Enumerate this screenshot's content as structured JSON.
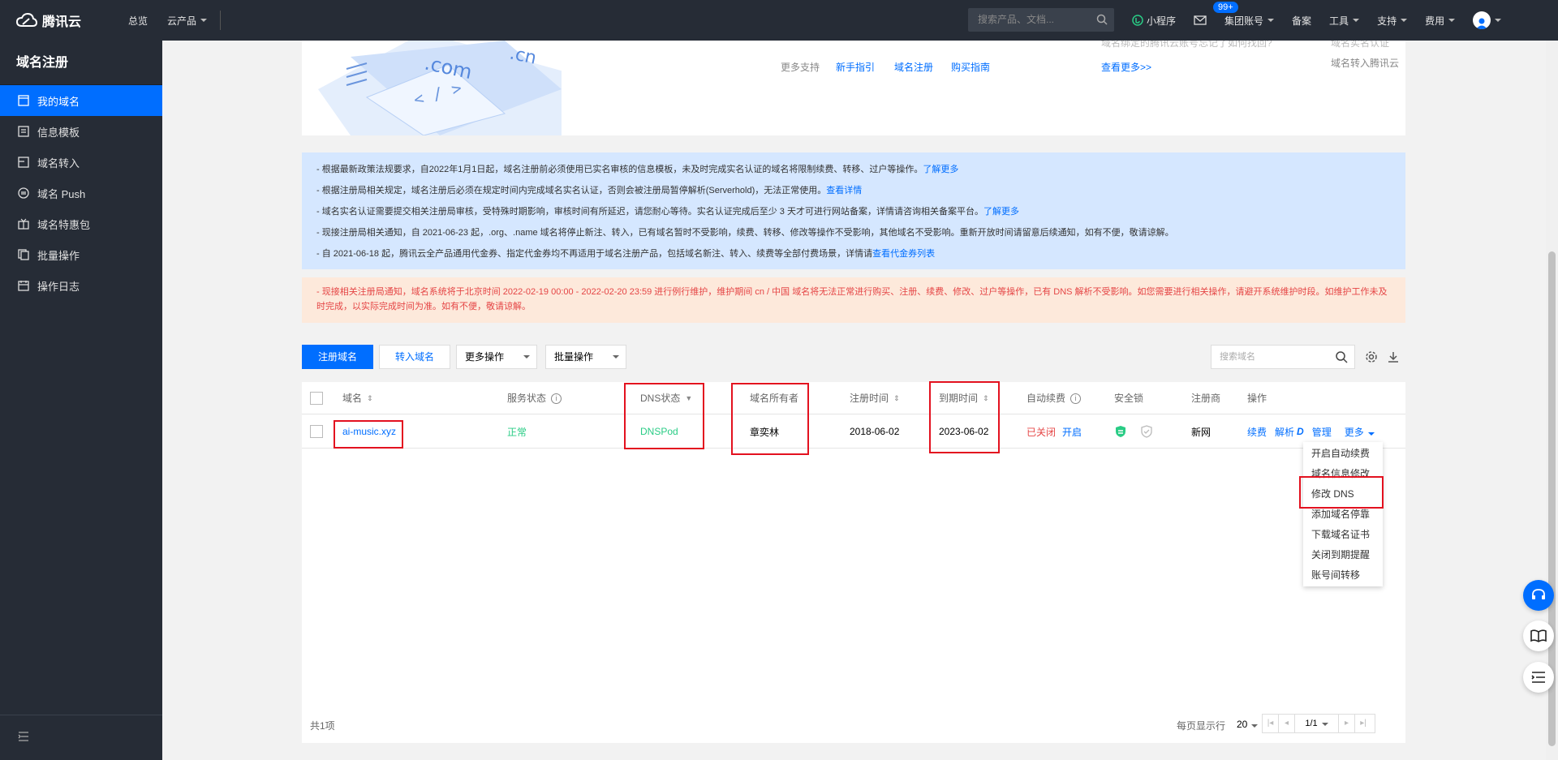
{
  "topbar": {
    "logo": "腾讯云",
    "nav": [
      "总览",
      "云产品"
    ],
    "search_placeholder": "搜索产品、文档...",
    "miniprogram": "小程序",
    "mail_badge": "99+",
    "group_account": "集团账号",
    "beian": "备案",
    "tools": "工具",
    "support": "支持",
    "billing": "费用"
  },
  "sidebar": {
    "title": "域名注册",
    "items": [
      {
        "label": "我的域名",
        "active": true
      },
      {
        "label": "信息模板"
      },
      {
        "label": "域名转入"
      },
      {
        "label": "域名 Push"
      },
      {
        "label": "域名特惠包"
      },
      {
        "label": "批量操作"
      },
      {
        "label": "操作日志"
      }
    ]
  },
  "banner": {
    "art_text_1": ".com",
    "art_text_2": ".cn",
    "more_support": "更多支持",
    "newbie_guide": "新手指引",
    "domain_reg": "域名注册",
    "buy_guide": "购买指南",
    "faded_q": "域名绑定的腾讯云账号忘记了如何找回?",
    "see_more": "查看更多>>",
    "faded_r1": "域名实名认证",
    "faded_r2": "域名转入腾讯云"
  },
  "notices": {
    "blue": [
      {
        "text": "- 根据最新政策法规要求，自2022年1月1日起，域名注册前必须使用已实名审核的信息模板，未及时完成实名认证的域名将限制续费、转移、过户等操作。",
        "link": "了解更多"
      },
      {
        "text": "- 根据注册局相关规定，域名注册后必须在规定时间内完成域名实名认证，否则会被注册局暂停解析(Serverhold)，无法正常使用。",
        "link": "查看详情"
      },
      {
        "text": "- 域名实名认证需要提交相关注册局审核，受特殊时期影响，审核时间有所延迟，请您耐心等待。实名认证完成后至少 3 天才可进行网站备案，详情请咨询相关备案平台。",
        "link": "了解更多"
      },
      {
        "text": "- 现接注册局相关通知，自 2021-06-23 起，.org、.name 域名将停止新注、转入，已有域名暂时不受影响，续费、转移、修改等操作不受影响，其他域名不受影响。重新开放时间请留意后续通知，如有不便，敬请谅解。",
        "link": ""
      },
      {
        "text": "- 自 2021-06-18 起，腾讯云全产品通用代金券、指定代金券均不再适用于域名注册产品，包括域名新注、转入、续费等全部付费场景，详情请",
        "link": "查看代金券列表"
      }
    ],
    "orange": "- 现接相关注册局通知，域名系统将于北京时间 2022-02-19 00:00 - 2022-02-20 23:59 进行例行维护，维护期间 cn / 中国 域名将无法正常进行购买、注册、续费、修改、过户等操作，已有 DNS 解析不受影响。如您需要进行相关操作，请避开系统维护时段。如维护工作未及时完成，以实际完成时间为准。如有不便，敬请谅解。"
  },
  "toolbar": {
    "register": "注册域名",
    "transfer": "转入域名",
    "more_ops": "更多操作",
    "batch_ops": "批量操作",
    "search_placeholder": "搜索域名"
  },
  "table": {
    "headers": {
      "domain": "域名",
      "service_status": "服务状态",
      "dns_status": "DNS状态",
      "owner": "域名所有者",
      "reg_time": "注册时间",
      "expire_time": "到期时间",
      "auto_renew": "自动续费",
      "security_lock": "安全锁",
      "registrar": "注册商",
      "actions": "操作"
    },
    "row": {
      "domain": "ai-music.xyz",
      "service_status": "正常",
      "dns_status": "DNSPod",
      "owner": "章奕林",
      "reg_time": "2018-06-02",
      "expire_time": "2023-06-02",
      "auto_renew_off": "已关闭",
      "auto_renew_on": "开启",
      "registrar": "新网",
      "act_renew": "续费",
      "act_resolve": "解析",
      "act_manage": "管理",
      "act_more": "更多"
    },
    "more_menu": [
      "开启自动续费",
      "域名信息修改",
      "修改 DNS",
      "添加域名停靠",
      "下载域名证书",
      "关闭到期提醒",
      "账号间转移"
    ],
    "footer": {
      "total": "共1项",
      "per_page_label": "每页显示行",
      "per_page": "20",
      "page": "1/1"
    }
  },
  "colors": {
    "accent": "#006eff",
    "topbar_bg": "#262c36",
    "highlight_red": "#e3111f",
    "status_green": "#29cc85",
    "closed_red": "#e54545"
  }
}
